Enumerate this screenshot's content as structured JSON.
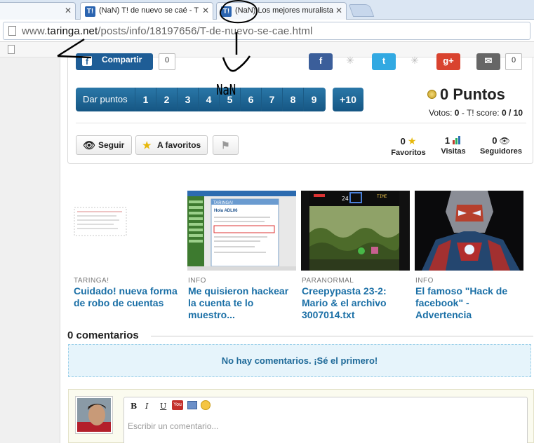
{
  "browser": {
    "tabs": [
      {
        "title": "",
        "active": false
      },
      {
        "title": "(NaN) T! de nuevo se caé - T",
        "active": true
      },
      {
        "title": "(NaN) Los mejores muralistas",
        "active": false
      }
    ],
    "favicon_text": "T!",
    "url_prefix": "www.",
    "url_domain": "taringa.net",
    "url_path": "/posts/info/18197656/T-de-nuevo-se-cae.html"
  },
  "share": {
    "facebook_label": "Compartir",
    "facebook_count": "0",
    "counts": [
      "0",
      "0"
    ]
  },
  "points": {
    "label": "Dar puntos",
    "values": [
      "1",
      "2",
      "3",
      "4",
      "5",
      "6",
      "7",
      "8",
      "9"
    ],
    "plus": "+10",
    "total": "0 Puntos",
    "votes_label": "Votos:",
    "votes": "0",
    "score_label": "- T! score:",
    "score": "0 / 10"
  },
  "actions": {
    "follow": "Seguir",
    "favorite": "A favoritos"
  },
  "stats": [
    {
      "value": "0",
      "label": "Favoritos",
      "icon": "star-icon"
    },
    {
      "value": "1",
      "label": "Visitas",
      "icon": "bar-chart-icon"
    },
    {
      "value": "0",
      "label": "Seguidores",
      "icon": "eye-icon"
    }
  ],
  "related": [
    {
      "category": "TARINGA!",
      "title": "Cuidado! nueva forma de robo de cuentas"
    },
    {
      "category": "INFO",
      "title": "Me quisieron hackear la cuenta te lo muestro..."
    },
    {
      "category": "PARANORMAL",
      "title": "Creepypasta 23-2: Mario & el archivo 3007014.txt"
    },
    {
      "category": "INFO",
      "title": "El famoso \"Hack de facebook\" - Advertencia"
    }
  ],
  "thumb_text": {
    "taringa_screen_header": "TARINGA!",
    "taringa_screen_greeting": "Hola ADL06",
    "game_time": "TIME",
    "game_counter": "24"
  },
  "comments": {
    "heading": "0 comentarios",
    "empty": "No hay comentarios. ¡Sé el primero!",
    "placeholder": "Escribir un comentario...",
    "toolbar": [
      "B",
      "I",
      "U"
    ],
    "youtube_label": "You"
  },
  "annotation": {
    "label": "NaN"
  }
}
